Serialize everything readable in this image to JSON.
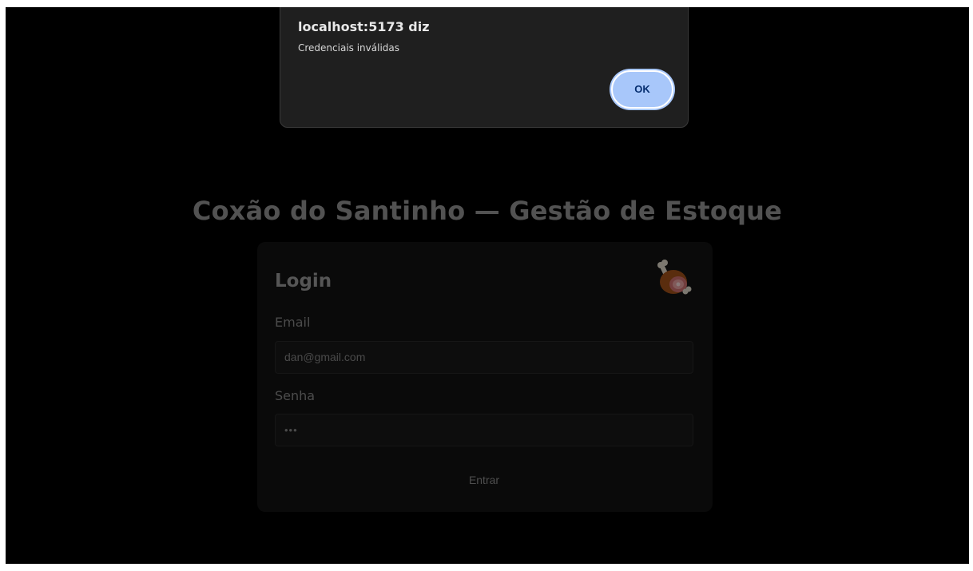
{
  "page": {
    "title": "Coxão do Santinho — Gestão de Estoque"
  },
  "login": {
    "heading": "Login",
    "icon": "meat-on-bone-icon",
    "email_label": "Email",
    "email_value": "dan@gmail.com",
    "password_label": "Senha",
    "password_value": "•••",
    "submit_label": "Entrar"
  },
  "alert": {
    "origin": "localhost:5173 diz",
    "message": "Credenciais inválidas",
    "ok_label": "OK",
    "ok_color": "#a8c7fa"
  }
}
